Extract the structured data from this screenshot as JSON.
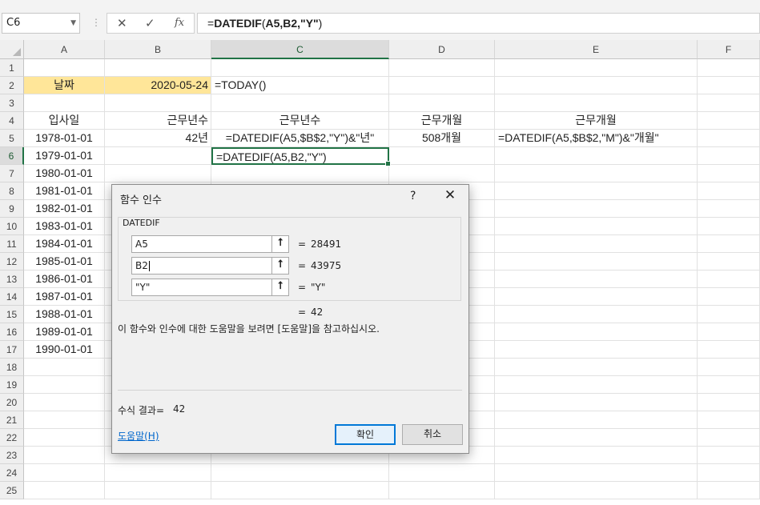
{
  "formula_bar": {
    "name_box": "C6",
    "formula_prefix": "=",
    "formula_fn": "DATEDIF",
    "formula_paren_open": "(",
    "formula_args": "A5,B2,\"Y\"",
    "formula_paren_close": ")",
    "cancel_glyph": "✕",
    "enter_glyph": "✓",
    "fx_glyph": "fx"
  },
  "sheet": {
    "columns": [
      "A",
      "B",
      "C",
      "D",
      "E",
      "F"
    ],
    "selected_column": "C",
    "rows": [
      "1",
      "2",
      "3",
      "4",
      "5",
      "6",
      "7",
      "8",
      "9",
      "10",
      "11",
      "12",
      "13",
      "14",
      "15",
      "16",
      "17",
      "18",
      "19",
      "20",
      "21",
      "22",
      "23",
      "24",
      "25"
    ],
    "selected_row": "6",
    "cells": {
      "A2": "날짜",
      "B2": "2020-05-24",
      "C2": "=TODAY()",
      "A4": "입사일",
      "B4": "근무년수",
      "C4": "근무년수",
      "D4": "근무개월",
      "E4": "근무개월",
      "A5": "1978-01-01",
      "B5": "42년",
      "C5": "=DATEDIF(A5,$B$2,\"Y\")&\"년\"",
      "D5": "508개월",
      "E5": "=DATEDIF(A5,$B$2,\"M\")&\"개월\"",
      "A6": "1979-01-01",
      "C6": "=DATEDIF(A5,B2,\"Y\")",
      "A7": "1980-01-01",
      "A8": "1981-01-01",
      "A9": "1982-01-01",
      "A10": "1983-01-01",
      "A11": "1984-01-01",
      "A12": "1985-01-01",
      "A13": "1986-01-01",
      "A14": "1987-01-01",
      "A15": "1988-01-01",
      "A16": "1989-01-01",
      "A17": "1990-01-01"
    }
  },
  "dialog": {
    "title": "함수 인수",
    "help_glyph": "?",
    "close_glyph": "✕",
    "function_name": "DATEDIF",
    "args": [
      {
        "value": "A5",
        "result": "28491"
      },
      {
        "value": "B2",
        "result": "43975"
      },
      {
        "value": "\"Y\"",
        "result": "\"Y\""
      }
    ],
    "equals": "=",
    "overall_result": "42",
    "description": "이 함수와 인수에 대한 도움말을 보려면 [도움말]을 참고하십시오.",
    "formula_result_label": "수식 결과=",
    "formula_result_value": "42",
    "help_link": "도움말(H)",
    "ok_label": "확인",
    "cancel_label": "취소",
    "ref_button_glyph": "⭡"
  },
  "colors": {
    "accent_green": "#217346",
    "highlight_yellow": "#ffe699",
    "link_blue": "#0066cc",
    "focus_blue": "#0078d7"
  }
}
